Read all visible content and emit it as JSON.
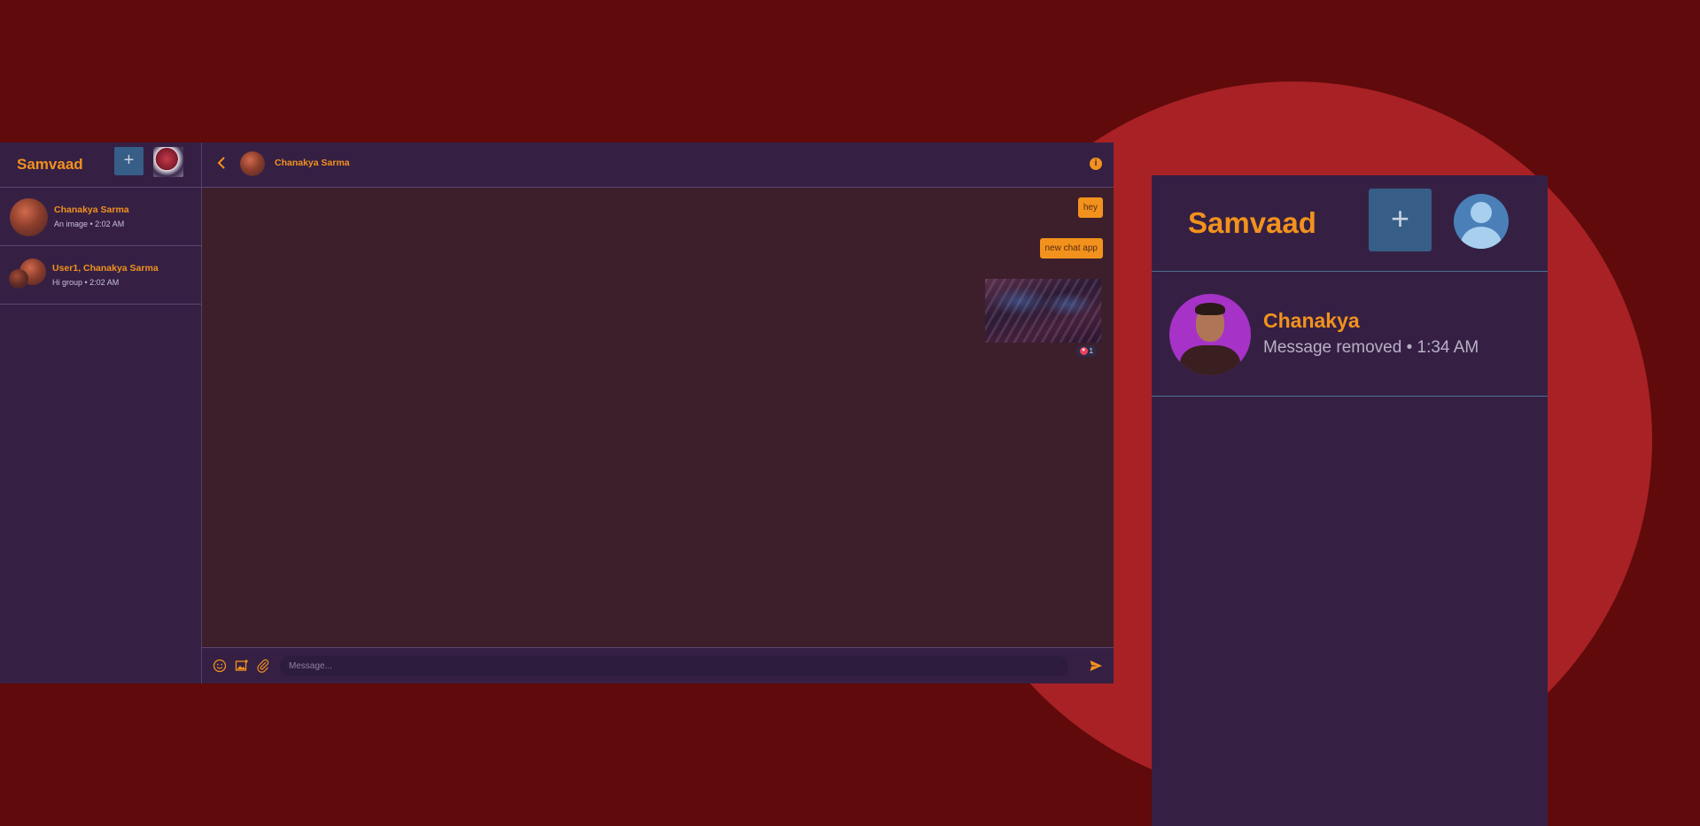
{
  "desktop": {
    "sidebar": {
      "brand": "Samvaad",
      "new_chat_label": "+",
      "chats": [
        {
          "name": "Chanakya Sarma",
          "subtitle": "An image • 2:02 AM"
        },
        {
          "name": "User1, Chanakya Sarma",
          "subtitle": "Hi group • 2:02 AM"
        }
      ]
    },
    "conversation": {
      "title": "Chanakya Sarma",
      "info_label": "i",
      "messages": [
        {
          "type": "text",
          "text": "hey"
        },
        {
          "type": "text",
          "text": "new chat app"
        },
        {
          "type": "image",
          "reaction_count": "1"
        }
      ],
      "composer": {
        "placeholder": "Message..."
      }
    }
  },
  "mobile": {
    "brand": "Samvaad",
    "new_chat_label": "+",
    "chats": [
      {
        "name": "Chanakya",
        "subtitle": "Message removed • 1:34 AM"
      }
    ]
  },
  "colors": {
    "background": "#600a0b",
    "circle": "#a82125",
    "panel": "#352044",
    "chat_area": "#3d1f2b",
    "accent": "#f2921d",
    "button": "#365e86"
  },
  "icons": [
    "chevron-left-icon",
    "info-icon",
    "emoji-icon",
    "image-icon",
    "attach-icon",
    "send-icon",
    "heart-icon",
    "user-icon"
  ]
}
